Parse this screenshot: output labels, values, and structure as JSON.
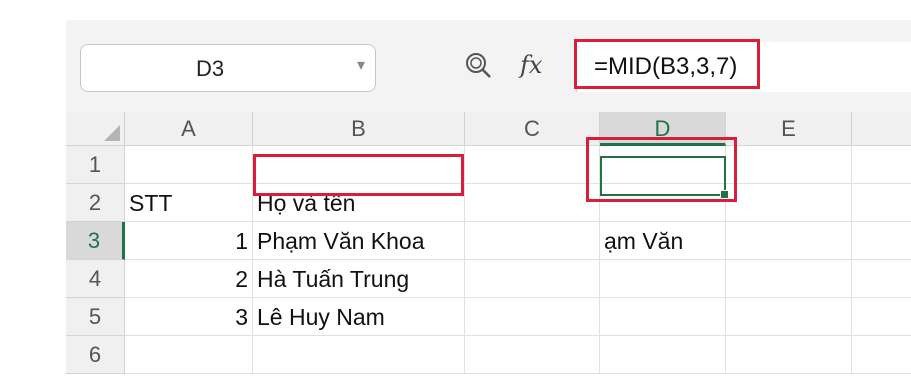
{
  "namebox": {
    "value": "D3"
  },
  "formula": {
    "fx_label": "fx",
    "text": "=MID(B3,3,7)"
  },
  "columns": [
    "A",
    "B",
    "C",
    "D",
    "E"
  ],
  "rows": [
    "1",
    "2",
    "3",
    "4",
    "5",
    "6"
  ],
  "cells": {
    "A2": "STT",
    "B2": "Họ và tên",
    "A3": "1",
    "B3": "Phạm Văn Khoa",
    "D3": "ạm Văn",
    "A4": "2",
    "B4": "Hà Tuấn Trung",
    "A5": "3",
    "B5": "Lê Huy Nam"
  },
  "colors": {
    "accent": "#217346",
    "highlight": "#d81e3c"
  }
}
